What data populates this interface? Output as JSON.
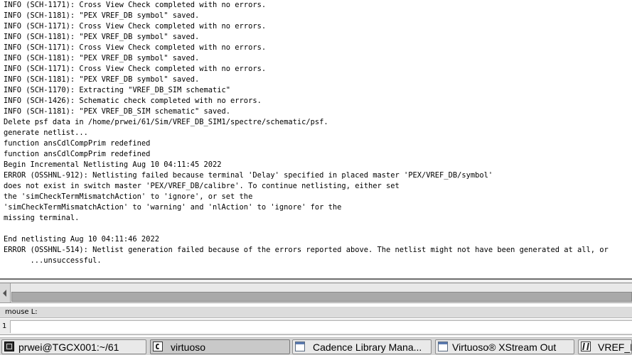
{
  "log": {
    "lines": [
      "INFO (SCH-1171): Cross View Check completed with no errors.",
      "INFO (SCH-1181): \"PEX VREF_DB symbol\" saved.",
      "INFO (SCH-1171): Cross View Check completed with no errors.",
      "INFO (SCH-1181): \"PEX VREF_DB symbol\" saved.",
      "INFO (SCH-1171): Cross View Check completed with no errors.",
      "INFO (SCH-1181): \"PEX VREF_DB symbol\" saved.",
      "INFO (SCH-1171): Cross View Check completed with no errors.",
      "INFO (SCH-1181): \"PEX VREF_DB symbol\" saved.",
      "INFO (SCH-1170): Extracting \"VREF_DB_SIM schematic\"",
      "INFO (SCH-1426): Schematic check completed with no errors.",
      "INFO (SCH-1181): \"PEX VREF_DB_SIM schematic\" saved.",
      "Delete psf data in /home/prwei/61/Sim/VREF_DB_SIM1/spectre/schematic/psf.",
      "generate netlist...",
      "function ansCdlCompPrim redefined",
      "function ansCdlCompPrim redefined",
      "Begin Incremental Netlisting Aug 10 04:11:45 2022",
      "ERROR (OSSHNL-912): Netlisting failed because terminal 'Delay' specified in placed master 'PEX/VREF_DB/symbol'",
      "does not exist in switch master 'PEX/VREF_DB/calibre'. To continue netlisting, either set",
      "the 'simCheckTermMismatchAction' to 'ignore', or set the",
      "'simCheckTermMismatchAction' to 'warning' and 'nlAction' to 'ignore' for the",
      "missing terminal.",
      "",
      "End netlisting Aug 10 04:11:46 2022",
      "ERROR (OSSHNL-514): Netlist generation failed because of the errors reported above. The netlist might not have been generated at all, or",
      "      ...unsuccessful."
    ]
  },
  "mouse_bar": {
    "label": "mouse L:"
  },
  "status_bar": {
    "line_number": "1"
  },
  "taskbar": {
    "items": [
      {
        "label": "prwei@TGCX001:~/61",
        "icon": "terminal-icon"
      },
      {
        "label": "virtuoso",
        "icon": "cadence-c-icon",
        "active": true
      },
      {
        "label": "Cadence Library Mana...",
        "icon": "window-icon"
      },
      {
        "label": "Virtuoso® XStream Out",
        "icon": "window-icon"
      },
      {
        "label": "VREF_D",
        "icon": "virtuoso-icon"
      }
    ]
  }
}
